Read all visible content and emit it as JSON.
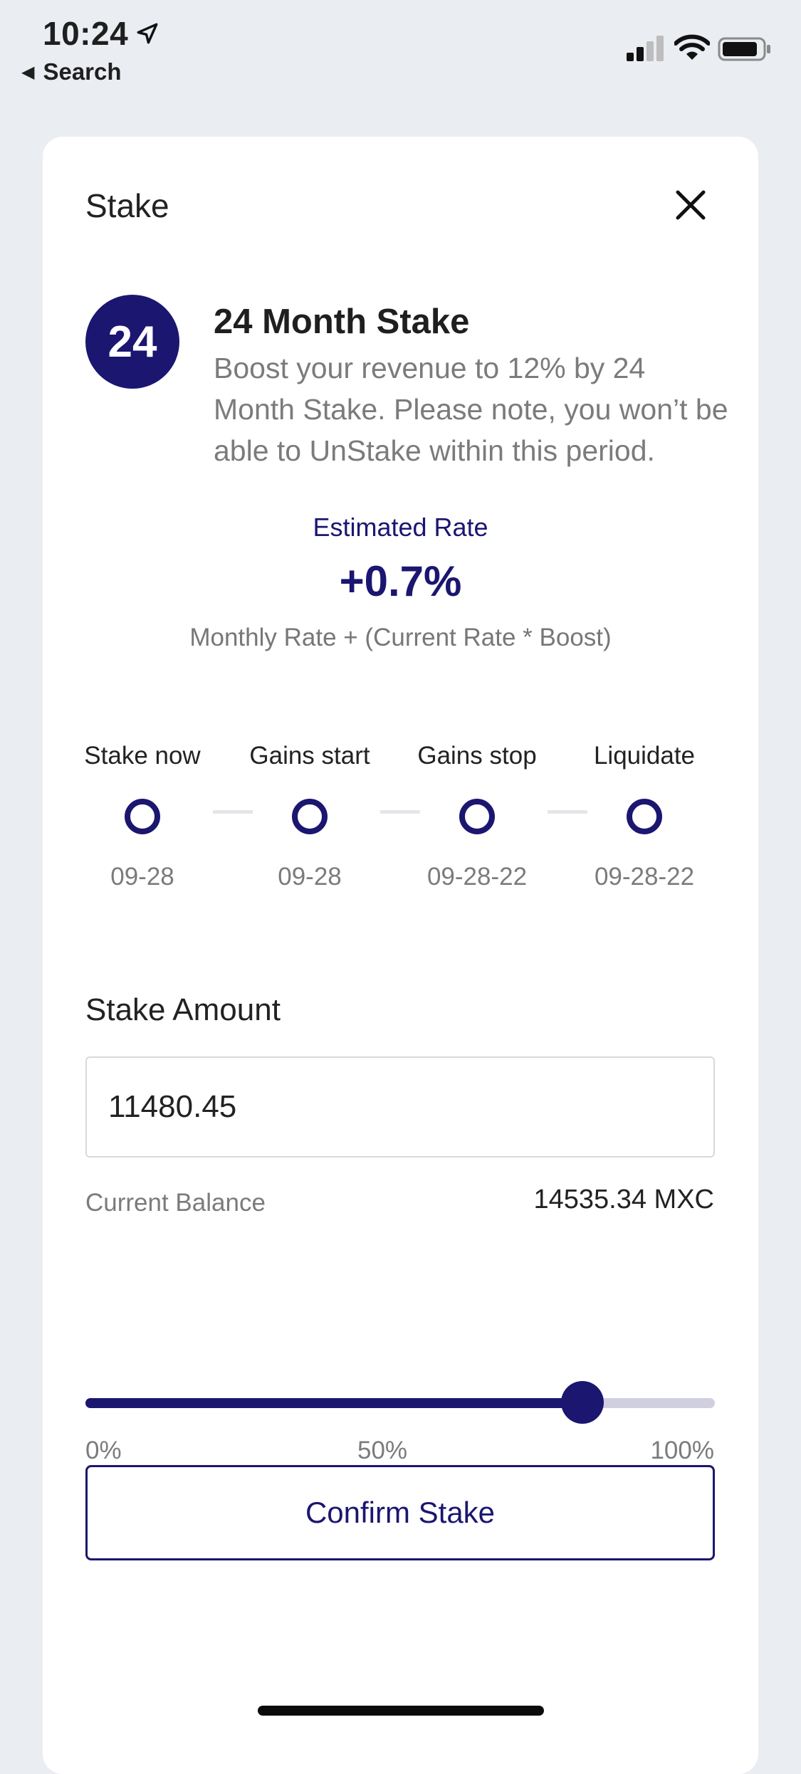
{
  "status_bar": {
    "time": "10:24",
    "back_label": "Search",
    "icons": [
      "location-arrow-icon",
      "cellular-signal-icon",
      "wifi-icon",
      "battery-icon"
    ]
  },
  "modal": {
    "title": "Stake",
    "close_icon": "close-icon"
  },
  "plan": {
    "badge": "24",
    "title": "24 Month Stake",
    "description": "Boost your revenue to 12% by 24 Month Stake. Please note, you won’t be able to UnStake within this period."
  },
  "rate": {
    "label": "Estimated Rate",
    "value": "+0.7%",
    "formula": "Monthly Rate + (Current Rate * Boost)"
  },
  "timeline": [
    {
      "label": "Stake now",
      "date": "09-28"
    },
    {
      "label": "Gains start",
      "date": "09-28"
    },
    {
      "label": "Gains stop",
      "date": "09-28-22"
    },
    {
      "label": "Liquidate",
      "date": "09-28-22"
    }
  ],
  "stake_amount": {
    "label": "Stake Amount",
    "value": "11480.45"
  },
  "balance": {
    "label": "Current Balance",
    "value": "14535.34 MXC"
  },
  "slider": {
    "value_fraction": 0.79,
    "ticks": [
      "0%",
      "50%",
      "100%"
    ]
  },
  "confirm_label": "Confirm Stake",
  "colors": {
    "accent": "#1b1670",
    "track": "#cfcfe0",
    "background": "#eaedf1"
  }
}
